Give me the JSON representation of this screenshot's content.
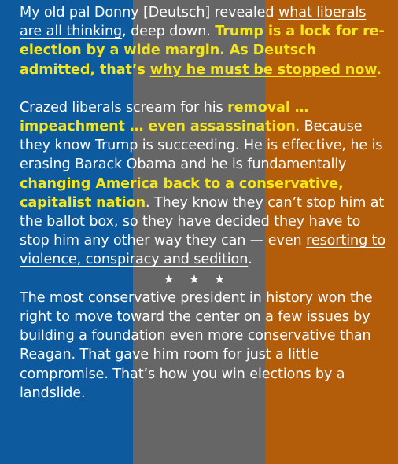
{
  "colors": {
    "stripe_left": "#0d5a9e",
    "stripe_middle": "#666666",
    "stripe_right": "#b35c0a",
    "text": "#ffffff",
    "highlight": "#f5e51c"
  },
  "p1": {
    "a": "My old pal Donny [Deutsch] revealed ",
    "link1": "what liberals are all thinking",
    "b": ", deep down. ",
    "hl1": "Trump is a lock for re-election by a wide margin. As Deutsch admitted, that’s ",
    "hl_link": "why he must be stopped now",
    "c": "."
  },
  "p2": {
    "a": "Crazed liberals scream for his ",
    "hl1": "removal … impeachment … even assassination",
    "b": ". Because they know Trump is succeeding. He is effective, he is erasing Barack Obama and he is fundamentally ",
    "hl2": "changing America back to a conservative, capitalist nation",
    "c": ". They know they can’t stop him at the ballot box, so they have decided they have to stop him any other way they can — even ",
    "link1": "resorting to violence, conspiracy and sedition",
    "d": "."
  },
  "separator": "★ ★ ★",
  "p3": "The most conservative president in history won the right to move toward the center on a few issues by building a foundation even more conservative than Reagan. That gave him room for just a little compromise. That’s how you win elections by a landslide."
}
